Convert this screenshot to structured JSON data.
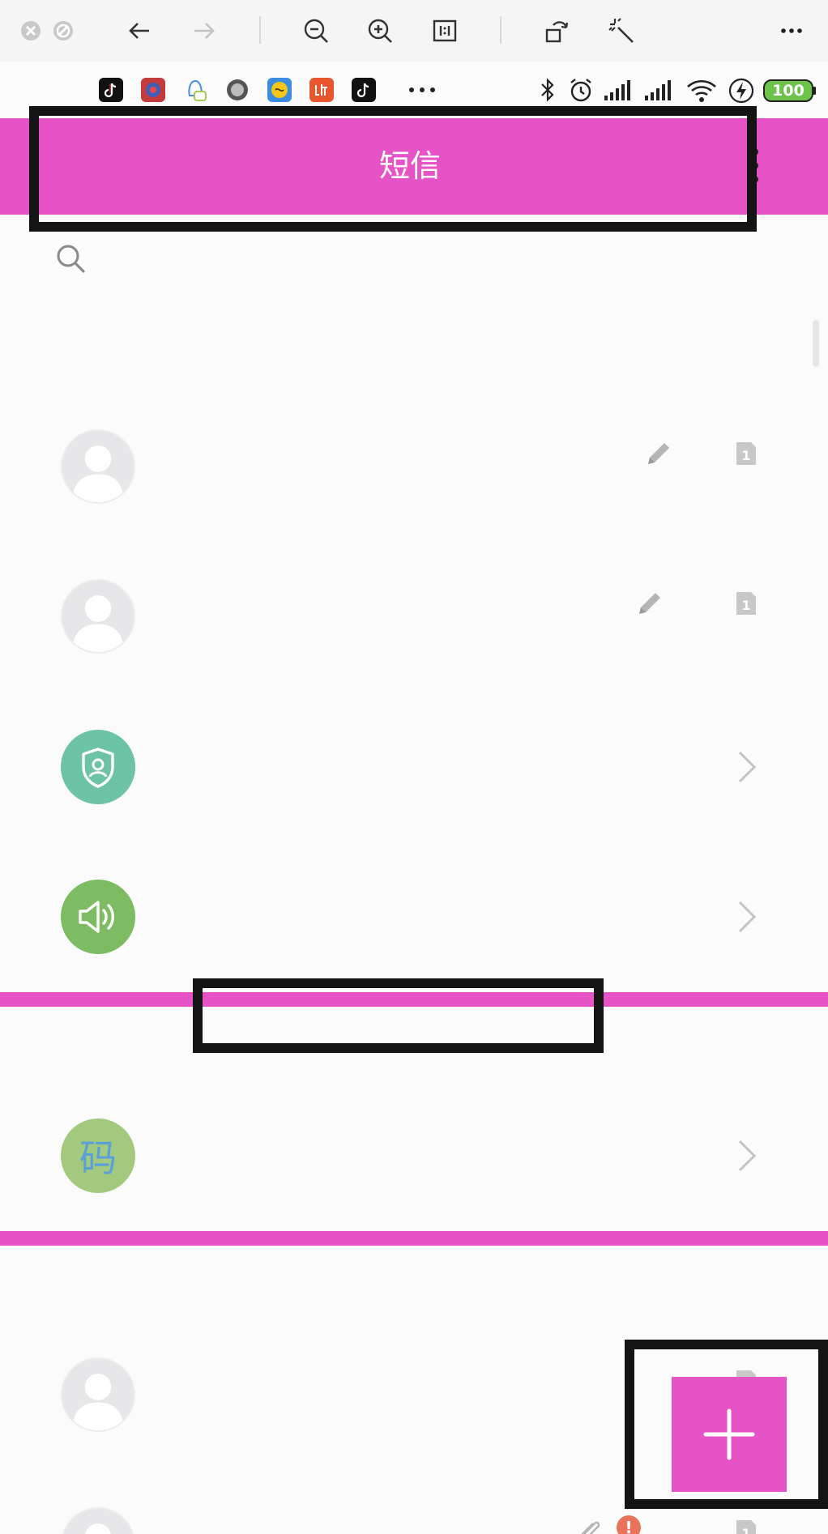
{
  "viewer_toolbar": {
    "icons": [
      "close-circle-icon",
      "stop-circle-icon",
      "back-arrow-icon",
      "forward-arrow-icon",
      "zoom-out-icon",
      "zoom-in-icon",
      "actual-size-icon",
      "rotate-icon",
      "magic-wand-icon",
      "more-icon"
    ]
  },
  "status_bar": {
    "apps": [
      "douyin-icon",
      "app-red-icon",
      "qq-icon",
      "app-gray-icon",
      "app-yellow-icon",
      "ting-icon",
      "douyin-icon"
    ],
    "battery": "100"
  },
  "header": {
    "title": "短信"
  },
  "conversations": [
    {
      "avatar": "person-icon",
      "trailing": [
        "edit-icon",
        "sim-1-icon"
      ]
    },
    {
      "avatar": "person-icon",
      "trailing": [
        "edit-icon",
        "sim-1-icon"
      ]
    },
    {
      "avatar": "shield-user-icon",
      "trailing": [
        "chevron-right-icon"
      ]
    },
    {
      "avatar": "speaker-icon",
      "trailing": [
        "chevron-right-icon"
      ]
    },
    {
      "avatar": "码",
      "trailing": [
        "chevron-right-icon"
      ]
    },
    {
      "avatar": "person-icon",
      "trailing": [
        "sim-1-icon"
      ]
    },
    {
      "avatar": "person-icon",
      "trailing": [
        "attachment-icon",
        "error-badge-icon",
        "sim-1-icon"
      ]
    }
  ],
  "sim_label": "1",
  "error_badge": "!",
  "fab": {
    "icon": "plus-icon"
  },
  "colors": {
    "accent": "#e653c7",
    "annotation": "#141414",
    "avatar_teal": "#6cc3a5",
    "avatar_green": "#7ebc64",
    "avatar_code": "#a3c97f"
  }
}
